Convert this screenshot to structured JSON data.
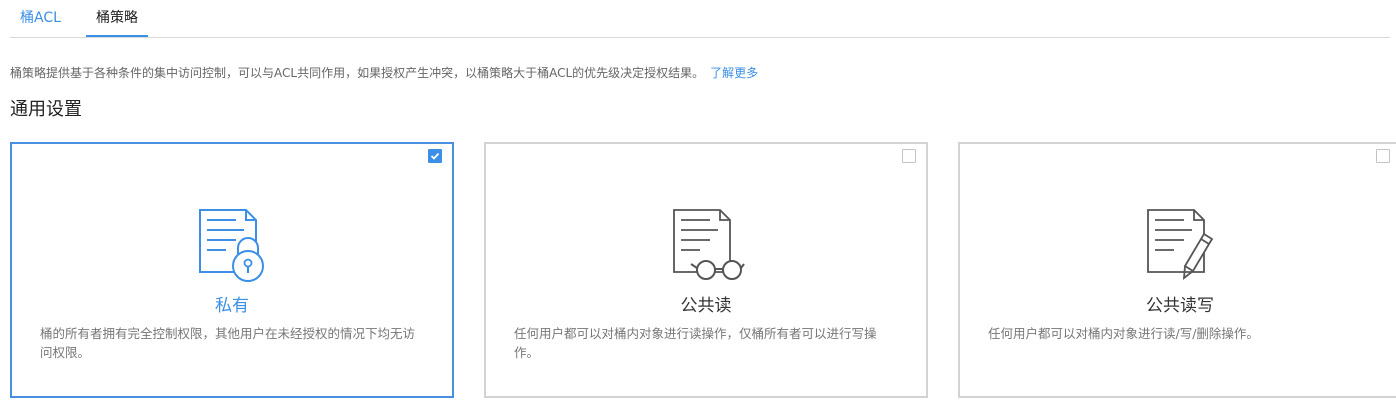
{
  "tabs": [
    {
      "label": "桶ACL"
    },
    {
      "label": "桶策略"
    }
  ],
  "description": {
    "text": "桶策略提供基于各种条件的集中访问控制，可以与ACL共同作用，如果授权产生冲突，以桶策略大于桶ACL的优先级决定授权结果。",
    "link_label": "了解更多"
  },
  "section_title": "通用设置",
  "cards": [
    {
      "title": "私有",
      "desc": "桶的所有者拥有完全控制权限，其他用户在未经授权的情况下均无访问权限。",
      "checked": true,
      "icon": "document-lock-icon"
    },
    {
      "title": "公共读",
      "desc": "任何用户都可以对桶内对象进行读操作，仅桶所有者可以进行写操作。",
      "checked": false,
      "icon": "document-glasses-icon"
    },
    {
      "title": "公共读写",
      "desc": "任何用户都可以对桶内对象进行读/写/删除操作。",
      "checked": false,
      "icon": "document-pencil-icon"
    }
  ],
  "colors": {
    "accent": "#3b8fe6",
    "border": "#d3d3d3",
    "text": "#333333",
    "muted": "#777777"
  }
}
